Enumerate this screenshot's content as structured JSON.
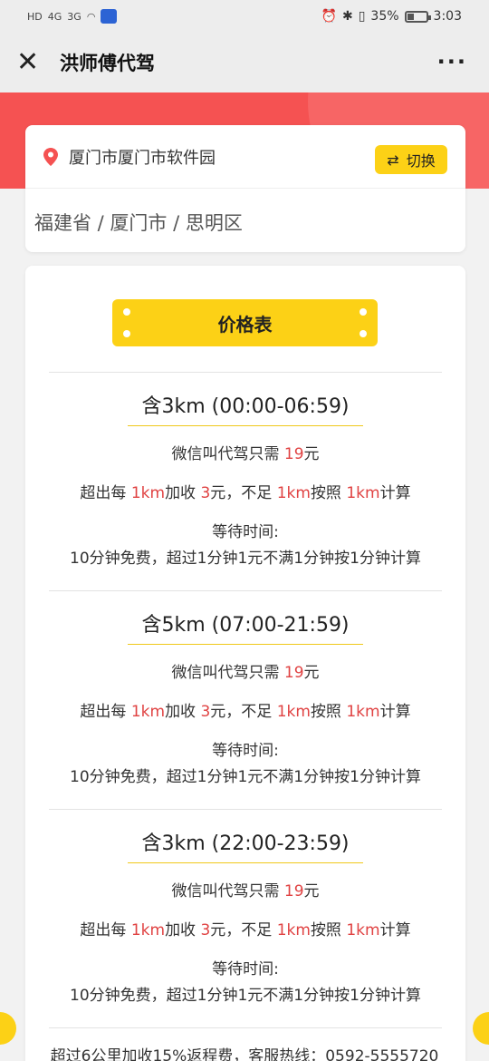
{
  "status_bar": {
    "left_icons": [
      "HD",
      "4G",
      "3G",
      "wifi",
      "1"
    ],
    "right_icons": [
      "alarm-icon",
      "bluetooth-icon",
      "vibrate-icon"
    ],
    "battery": "35%",
    "time": "3:03"
  },
  "title_bar": {
    "title": "洪师傅代驾"
  },
  "location": {
    "name": "厦门市厦门市软件园",
    "switch_label": "切换",
    "region": "福建省 / 厦门市 / 思明区"
  },
  "price_table": {
    "header": "价格表",
    "tiers": [
      {
        "title": "含3km (00:00-06:59)",
        "line1_prefix": "微信叫代驾只需 ",
        "price": "19",
        "line1_suffix": "元",
        "l2_a": "超出每 ",
        "l2_b": "1km",
        "l2_c": "加收 ",
        "l2_d": "3",
        "l2_e": "元，不足 ",
        "l2_f": "1km",
        "l2_g": "按照 ",
        "l2_h": "1km",
        "l2_i": "计算",
        "wait_label": "等待时间:",
        "wait_text": "10分钟免费，超过1分钟1元不满1分钟按1分钟计算"
      },
      {
        "title": "含5km (07:00-21:59)",
        "line1_prefix": "微信叫代驾只需 ",
        "price": "19",
        "line1_suffix": "元",
        "l2_a": "超出每 ",
        "l2_b": "1km",
        "l2_c": "加收 ",
        "l2_d": "3",
        "l2_e": "元，不足 ",
        "l2_f": "1km",
        "l2_g": "按照 ",
        "l2_h": "1km",
        "l2_i": "计算",
        "wait_label": "等待时间:",
        "wait_text": "10分钟免费，超过1分钟1元不满1分钟按1分钟计算"
      },
      {
        "title": "含3km (22:00-23:59)",
        "line1_prefix": "微信叫代驾只需 ",
        "price": "19",
        "line1_suffix": "元",
        "l2_a": "超出每 ",
        "l2_b": "1km",
        "l2_c": "加收 ",
        "l2_d": "3",
        "l2_e": "元，不足 ",
        "l2_f": "1km",
        "l2_g": "按照 ",
        "l2_h": "1km",
        "l2_i": "计算",
        "wait_label": "等待时间:",
        "wait_text": "10分钟免费，超过1分钟1元不满1分钟按1分钟计算"
      }
    ],
    "footer": "超过6公里加收15%返程费，客服热线：0592-5555720"
  },
  "colors": {
    "accent_yellow": "#fcd116",
    "banner_red": "#f55252",
    "price_red": "#e04343"
  }
}
